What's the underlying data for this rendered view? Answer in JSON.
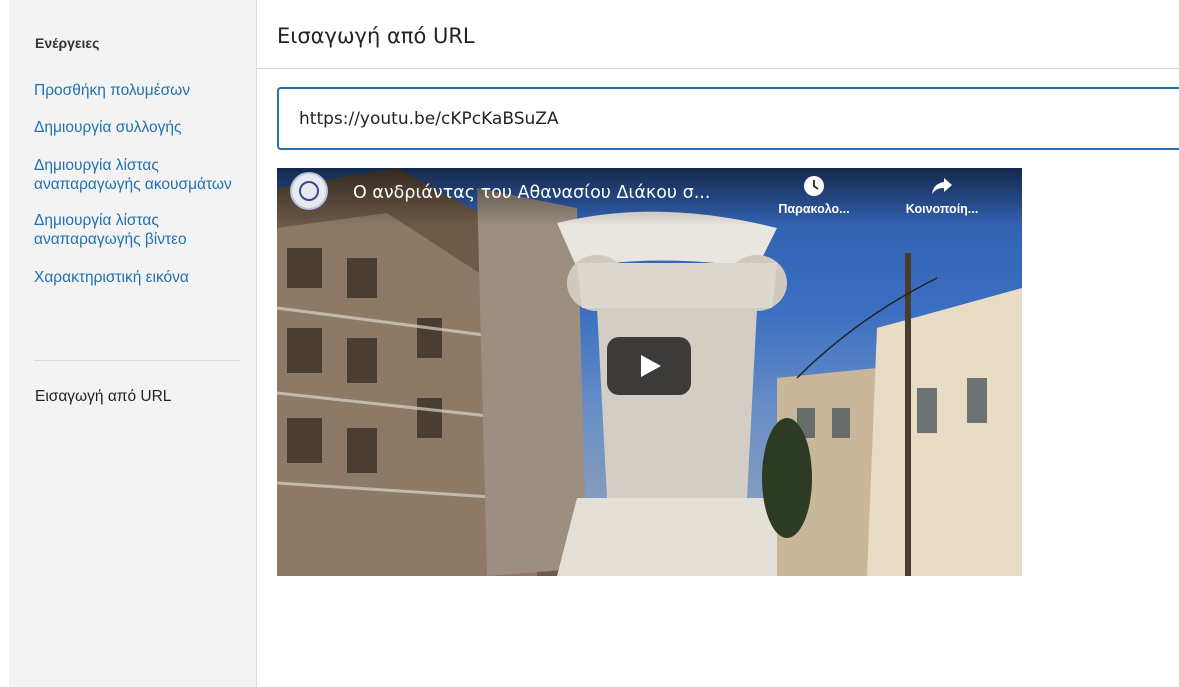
{
  "sidebar": {
    "heading": "Ενέργειες",
    "items": [
      {
        "label": "Προσθήκη πολυμέσων"
      },
      {
        "label": "Δημιουργία συλλογής"
      },
      {
        "label": "Δημιουργία λίστας αναπαραγωγής ακουσμάτων"
      },
      {
        "label": "Δημιουργία λίστας αναπαραγωγής βίντεο"
      },
      {
        "label": "Χαρακτηριστική εικόνα"
      }
    ],
    "current": "Εισαγωγή από URL"
  },
  "main": {
    "title": "Εισαγωγή από URL",
    "url_value": "https://youtu.be/cKPcKaBSuZA"
  },
  "video": {
    "title": "Ο ανδριάντας του Αθανασίου Διάκου σ...",
    "watch_later_label": "Παρακολο...",
    "share_label": "Κοινοποίη...",
    "play_icon": "play-icon"
  },
  "colors": {
    "accent": "#2271b1",
    "sidebar_bg": "#f3f3f3"
  }
}
